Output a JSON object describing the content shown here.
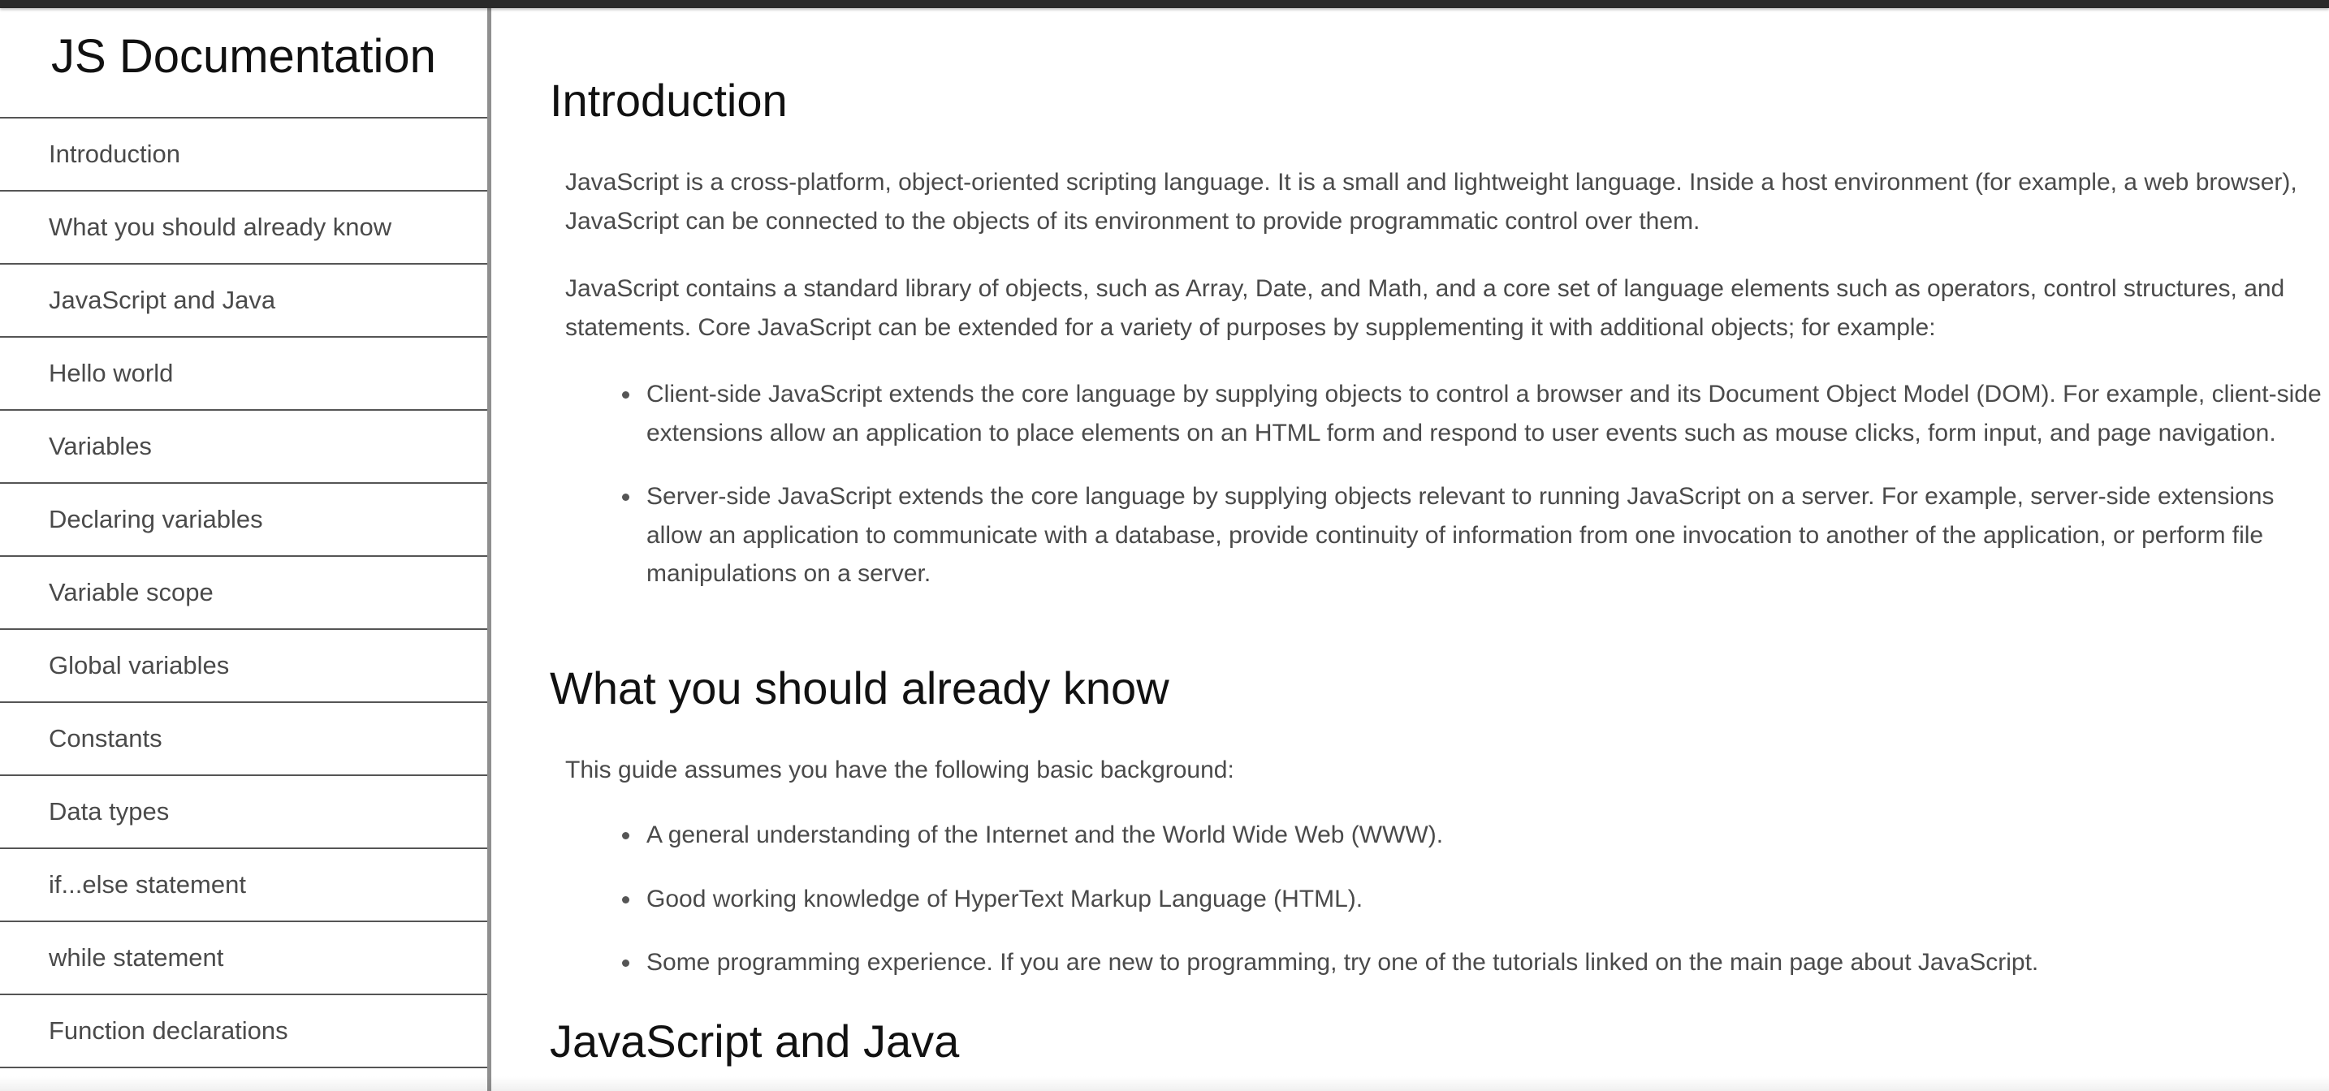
{
  "sidebar": {
    "title": "JS Documentation",
    "items": [
      {
        "label": "Introduction"
      },
      {
        "label": "What you should already know"
      },
      {
        "label": "JavaScript and Java"
      },
      {
        "label": "Hello world"
      },
      {
        "label": "Variables"
      },
      {
        "label": "Declaring variables"
      },
      {
        "label": "Variable scope"
      },
      {
        "label": "Global variables"
      },
      {
        "label": "Constants"
      },
      {
        "label": "Data types"
      },
      {
        "label": "if...else statement"
      },
      {
        "label": "while statement"
      },
      {
        "label": "Function declarations"
      }
    ]
  },
  "main": {
    "introduction": {
      "heading": "Introduction",
      "p1": "JavaScript is a cross-platform, object-oriented scripting language. It is a small and lightweight language. Inside a host environment (for example, a web browser), JavaScript can be connected to the objects of its environment to provide programmatic control over them.",
      "p2": "JavaScript contains a standard library of objects, such as Array, Date, and Math, and a core set of language elements such as operators, control structures, and statements. Core JavaScript can be extended for a variety of purposes by supplementing it with additional objects; for example:",
      "bullets": [
        "Client-side JavaScript extends the core language by supplying objects to control a browser and its Document Object Model (DOM). For example, client-side extensions allow an application to place elements on an HTML form and respond to user events such as mouse clicks, form input, and page navigation.",
        "Server-side JavaScript extends the core language by supplying objects relevant to running JavaScript on a server. For example, server-side extensions allow an application to communicate with a database, provide continuity of information from one invocation to another of the application, or perform file manipulations on a server."
      ]
    },
    "what_you_should_know": {
      "heading": "What you should already know",
      "p1": "This guide assumes you have the following basic background:",
      "bullets": [
        "A general understanding of the Internet and the World Wide Web (WWW).",
        "Good working knowledge of HyperText Markup Language (HTML).",
        "Some programming experience. If you are new to programming, try one of the tutorials linked on the main page about JavaScript."
      ]
    },
    "javascript_and_java": {
      "heading": "JavaScript and Java"
    }
  }
}
